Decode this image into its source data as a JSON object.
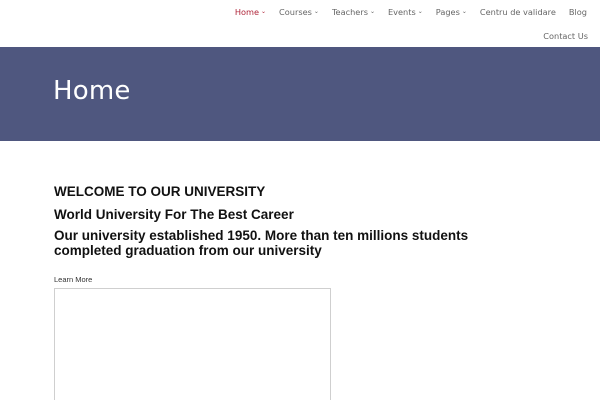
{
  "nav": {
    "items": [
      {
        "label": "Home",
        "has_dropdown": true,
        "active": true
      },
      {
        "label": "Courses",
        "has_dropdown": true,
        "active": false
      },
      {
        "label": "Teachers",
        "has_dropdown": true,
        "active": false
      },
      {
        "label": "Events",
        "has_dropdown": true,
        "active": false
      },
      {
        "label": "Pages",
        "has_dropdown": true,
        "active": false
      },
      {
        "label": "Centru de validare",
        "has_dropdown": false,
        "active": false
      },
      {
        "label": "Blog",
        "has_dropdown": false,
        "active": false
      }
    ],
    "second_row": [
      {
        "label": "Contact Us"
      }
    ],
    "active_color": "#b0263a"
  },
  "hero": {
    "title": "Home",
    "background": "#4f577f"
  },
  "content": {
    "welcome": "WELCOME TO OUR UNIVERSITY",
    "subtitle": "World University For The Best Career",
    "description": "Our university established 1950. More than ten millions students completed graduation from our university",
    "learn_more": "Learn More"
  }
}
